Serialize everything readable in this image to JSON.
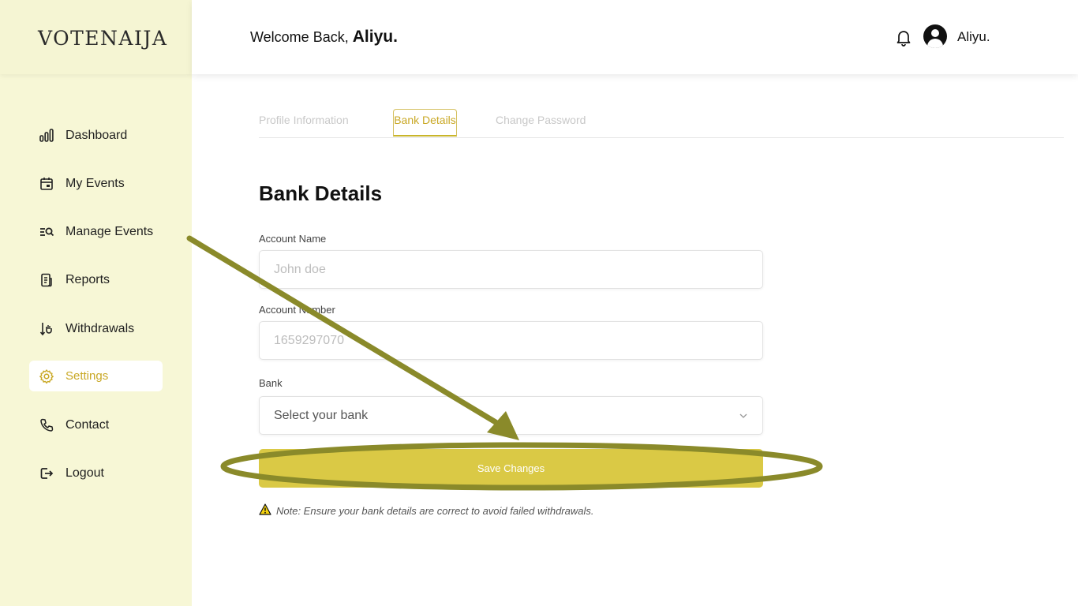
{
  "brand": {
    "logo_text": "VOTENAIJA",
    "accent": "#dac945",
    "sidebar_bg": "#f7f7d6"
  },
  "header": {
    "welcome_prefix": "Welcome Back,",
    "welcome_name": "Aliyu.",
    "user_name": "Aliyu."
  },
  "sidebar": {
    "items": [
      {
        "label": "Dashboard",
        "icon": "bar-chart-icon"
      },
      {
        "label": "My Events",
        "icon": "calendar-icon"
      },
      {
        "label": "Manage Events",
        "icon": "search-list-icon"
      },
      {
        "label": "Reports",
        "icon": "document-icon"
      },
      {
        "label": "Withdrawals",
        "icon": "withdraw-icon"
      },
      {
        "label": "Settings",
        "icon": "gear-icon",
        "active": true
      },
      {
        "label": "Contact",
        "icon": "phone-icon"
      },
      {
        "label": "Logout",
        "icon": "logout-icon"
      }
    ]
  },
  "tabs": [
    {
      "label": "Profile Information"
    },
    {
      "label": "Bank Details",
      "active": true
    },
    {
      "label": "Change Password"
    }
  ],
  "form": {
    "title": "Bank Details",
    "account_name_label": "Account Name",
    "account_name_placeholder": "John doe",
    "account_number_label": "Account Number",
    "account_number_placeholder": "1659297070",
    "bank_label": "Bank",
    "bank_select_value": "Select your bank",
    "save_label": "Save Changes",
    "note": "Note: Ensure your bank details are correct to avoid failed withdrawals."
  }
}
